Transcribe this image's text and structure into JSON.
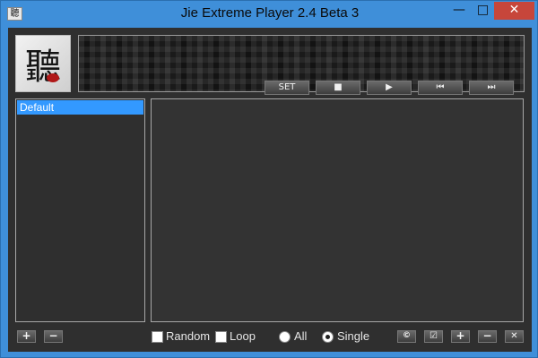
{
  "window": {
    "title": "Jie Extreme Player 2.4 Beta 3",
    "icon": "app-icon",
    "controls": {
      "minimize": "—",
      "maximize": "□",
      "close": "✕"
    }
  },
  "logo": {
    "glyph": "聽",
    "icon": "logo-image"
  },
  "transport": {
    "set": "SET",
    "stop": "■",
    "play": "▶",
    "prev": "⏮",
    "next": "⏭"
  },
  "playlists": [
    {
      "label": "Default",
      "selected": true
    }
  ],
  "bottom_left": {
    "add": "+",
    "remove": "−"
  },
  "options": {
    "random": {
      "label": "Random",
      "checked": false
    },
    "loop": {
      "label": "Loop",
      "checked": false
    },
    "all": {
      "label": "All",
      "selected": false
    },
    "single": {
      "label": "Single",
      "selected": true
    }
  },
  "bottom_right": {
    "copy": "©",
    "check": "☑",
    "add": "+",
    "remove": "−",
    "delete": "✕"
  },
  "colors": {
    "frame": "#3f8fd9",
    "client": "#2f2f2f",
    "selection": "#3399ff",
    "close": "#c7463b"
  }
}
